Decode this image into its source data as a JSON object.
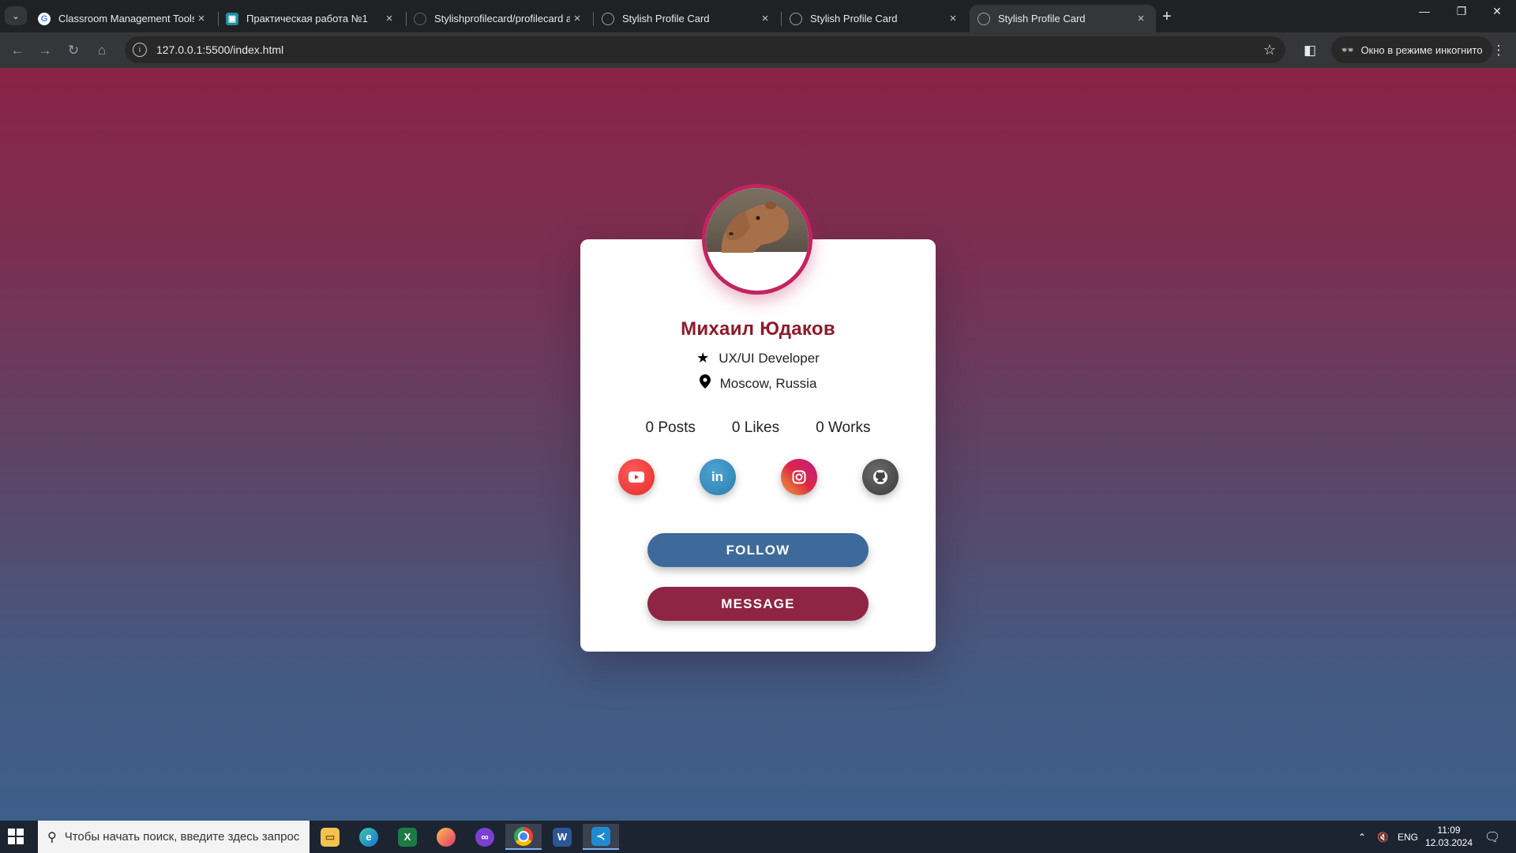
{
  "browser": {
    "tabs": [
      {
        "title": "Classroom Management Tools (",
        "favicon": "google-icon",
        "active": false
      },
      {
        "title": "Практическая работа №1",
        "favicon": "classroom-icon",
        "active": false
      },
      {
        "title": "Stylishprofilecard/profilecard at",
        "favicon": "github-icon",
        "active": false
      },
      {
        "title": "Stylish Profile Card",
        "favicon": "globe-icon",
        "active": false
      },
      {
        "title": "Stylish Profile Card",
        "favicon": "globe-icon",
        "active": false
      },
      {
        "title": "Stylish Profile Card",
        "favicon": "globe-icon",
        "active": true
      }
    ],
    "url": "127.0.0.1:5500/index.html",
    "incognito_label": "Окно в режиме инкогнито"
  },
  "profile": {
    "name": "Михаил Юдаков",
    "role": "UX/UI Developer",
    "location": "Moscow, Russia",
    "stats": [
      {
        "label": "0 Posts"
      },
      {
        "label": "0 Likes"
      },
      {
        "label": "0 Works"
      }
    ],
    "socials": [
      {
        "name": "youtube",
        "glyph": "▶"
      },
      {
        "name": "linkedin",
        "glyph": "in"
      },
      {
        "name": "instagram",
        "glyph": "◎"
      },
      {
        "name": "github",
        "glyph": "●"
      }
    ],
    "follow_label": "FOLLOW",
    "message_label": "MESSAGE",
    "accent_color": "#c2245f",
    "name_color": "#8e1a2c"
  },
  "taskbar": {
    "search_placeholder": "Чтобы начать поиск, введите здесь запрос",
    "language": "ENG",
    "time": "11:09",
    "date": "12.03.2024"
  }
}
